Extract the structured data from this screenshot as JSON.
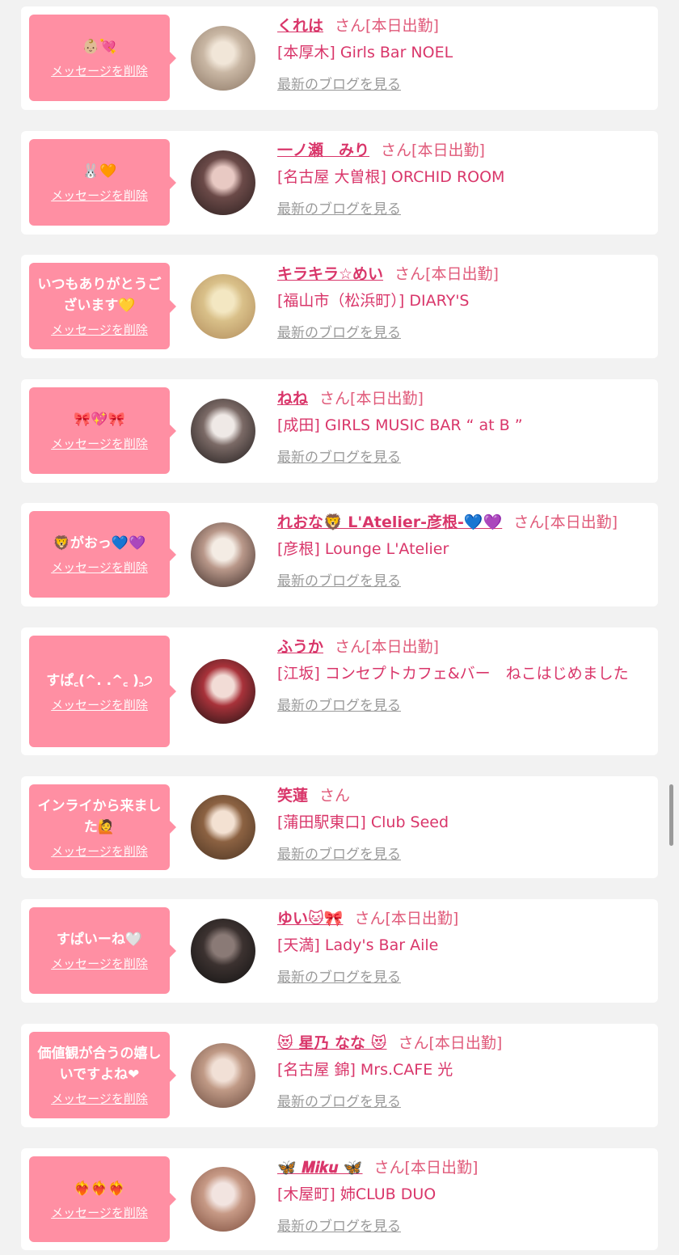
{
  "colors": {
    "background": "#f2f2f2",
    "card": "#ffffff",
    "bubble": "#ff8fa3",
    "name": "#d9366a",
    "link_gray": "#9a9a9a"
  },
  "delete_label": "メッセージを削除",
  "blog_label": "最新のブログを見る",
  "items": [
    {
      "message": "👶🏼💘",
      "name": "くれは",
      "name_is_link": true,
      "honorific": "さん",
      "status": "[本日出勤]",
      "shop": "[本厚木] Girls Bar NOEL",
      "avatar_colors": [
        "#f1e6d8",
        "#c9b7a4",
        "#8a7563"
      ]
    },
    {
      "message": "🐰🧡",
      "name": "一ノ瀬　みり",
      "name_is_link": true,
      "honorific": "さん",
      "status": "[本日出勤]",
      "shop": "[名古屋 大曽根] ORCHID ROOM",
      "avatar_colors": [
        "#e8c9c3",
        "#6b4a48",
        "#2a1e1e"
      ]
    },
    {
      "message": "いつもありがとうございます💛",
      "name": "キラキラ☆めい",
      "name_is_link": true,
      "honorific": "さん",
      "status": "[本日出勤]",
      "shop": "[福山市（松浜町）] DIARY'S",
      "avatar_colors": [
        "#f3e7c2",
        "#d9c089",
        "#b08a5a"
      ]
    },
    {
      "message": "🎀💖🎀",
      "name": "ねね",
      "name_is_link": true,
      "honorific": "さん",
      "status": "[本日出勤]",
      "shop": "[成田] GIRLS MUSIC BAR “ at B ”",
      "avatar_colors": [
        "#efe9e6",
        "#7b6a66",
        "#1e1a1a"
      ]
    },
    {
      "message": "🦁がおっ💙💜",
      "name": "れおな🦁 L'Atelier-彦根-💙💜",
      "name_is_link": true,
      "honorific": "さん",
      "status": "[本日出勤]",
      "shop": "[彦根] Lounge L'Atelier",
      "avatar_colors": [
        "#f4ece4",
        "#b9988a",
        "#3a2a26"
      ]
    },
    {
      "message": "すぱ꜀(^. .^꜀ )꜆੭",
      "name": "ふうか",
      "name_is_link": true,
      "honorific": "さん",
      "status": "[本日出勤]",
      "shop": "[江坂] コンセプトカフェ&バー　ねこはじめました",
      "avatar_colors": [
        "#f2dcd6",
        "#a8323a",
        "#1a1212"
      ]
    },
    {
      "message": "インライから来ました🙋",
      "name": "笑蓮",
      "name_is_link": false,
      "honorific": "さん",
      "status": "",
      "shop": "[蒲田駅東口] Club Seed",
      "avatar_colors": [
        "#f3e1d2",
        "#8c6242",
        "#4a3322"
      ]
    },
    {
      "message": "すぱいーね🤍",
      "name": "ゆい🐱🎀",
      "name_is_link": true,
      "honorific": "さん",
      "status": "[本日出勤]",
      "shop": "[天満] Lady's Bar Aile",
      "avatar_colors": [
        "#8a7a76",
        "#3c3230",
        "#111111"
      ]
    },
    {
      "message": "価値観が合うの嬉しいですよね❤",
      "name": "😻 星乃 なな 😻",
      "name_is_link": true,
      "honorific": "さん",
      "status": "[本日出勤]",
      "shop": "[名古屋 錦] Mrs.CAFE 光",
      "avatar_colors": [
        "#f1e0d6",
        "#c09a86",
        "#6a4a3e"
      ]
    },
    {
      "message": "❤️‍🔥❤️‍🔥❤️‍🔥",
      "name": "🦋 𝑴𝒊𝒌𝒖 🦋",
      "name_is_link": true,
      "honorific": "さん",
      "status": "[本日出勤]",
      "shop": "[木屋町] 姉CLUB DUO",
      "avatar_colors": [
        "#f2e4e0",
        "#c79a86",
        "#7a4a3a"
      ]
    }
  ]
}
